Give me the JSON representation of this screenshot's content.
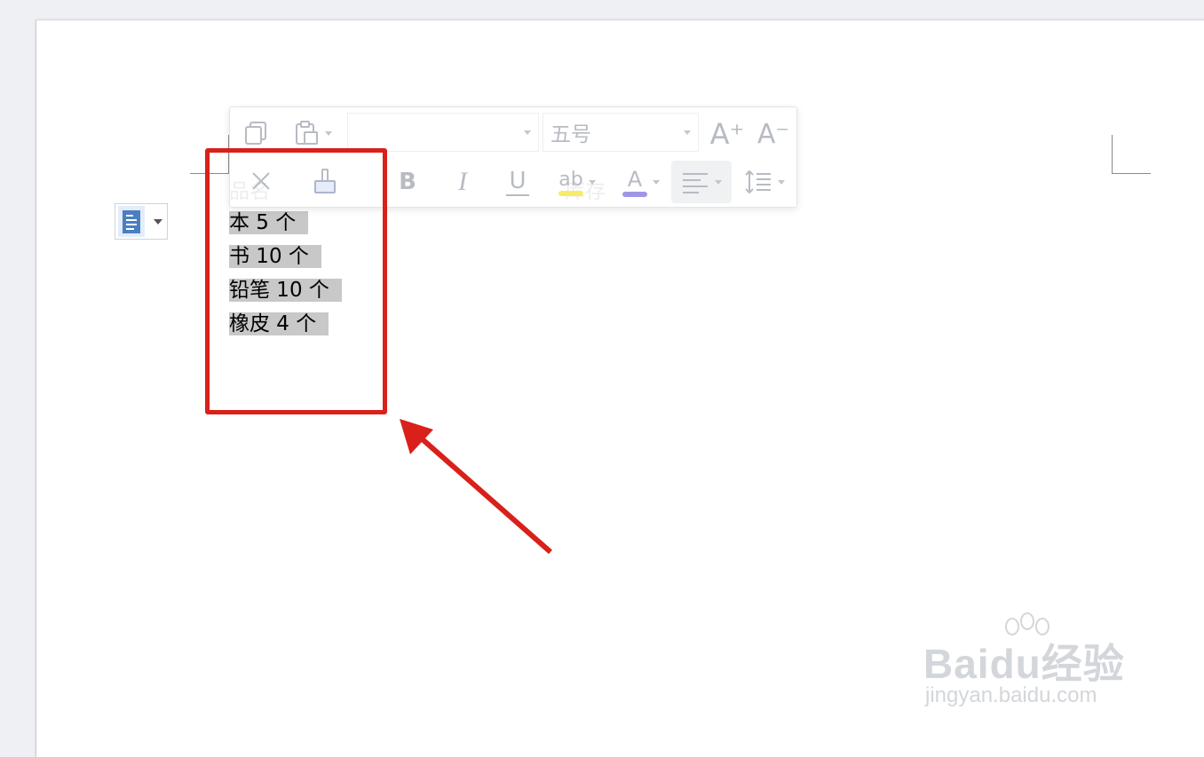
{
  "toolbar": {
    "font_name": "",
    "font_size": "五号",
    "grow_font_icon": "A⁺",
    "shrink_font_icon": "A⁻",
    "bold_glyph": "B",
    "italic_glyph": "I",
    "underline_glyph": "U",
    "highlight_glyph": "ab",
    "font_color_glyph": "A",
    "highlight_color": "#f7ec6a",
    "font_color_bar": "#9f97e6"
  },
  "document": {
    "header_left": "品名",
    "header_right": "库存",
    "rows": [
      "本 5 个",
      "书 10 个",
      "铅笔 10 个",
      "橡皮 4 个"
    ]
  },
  "watermark": {
    "logo": "Baidu经验",
    "url": "jingyan.baidu.com"
  },
  "annotation": {
    "box_color": "#d9201a"
  }
}
